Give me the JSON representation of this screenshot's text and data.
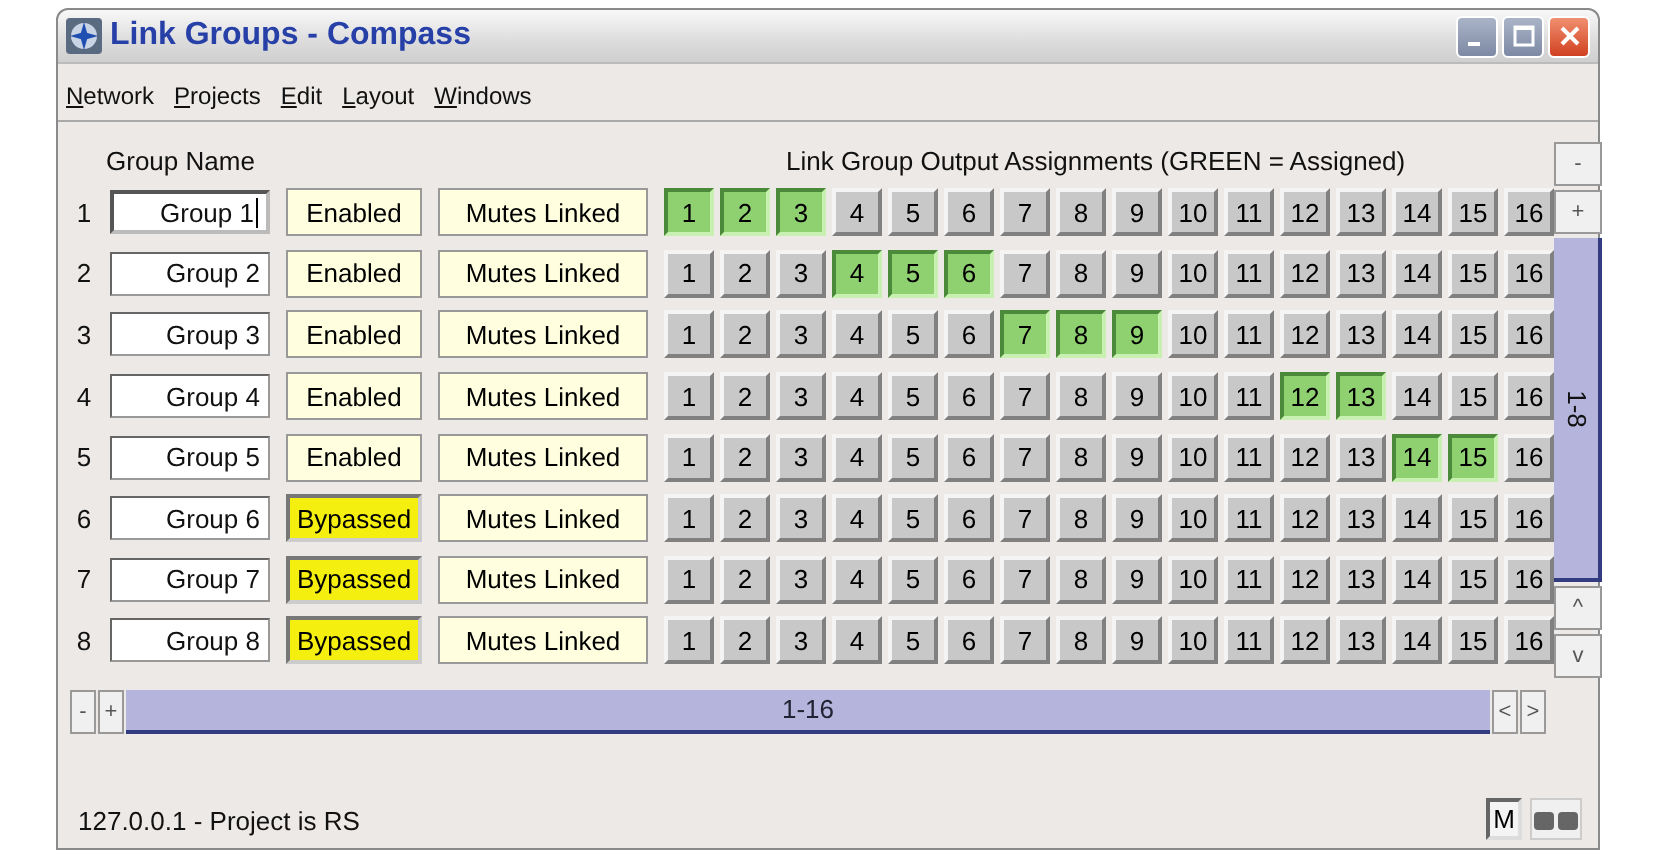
{
  "window": {
    "title": "Link Groups - Compass"
  },
  "menu": [
    {
      "label": "Network"
    },
    {
      "label": "Projects"
    },
    {
      "label": "Edit"
    },
    {
      "label": "Layout"
    },
    {
      "label": "Windows"
    }
  ],
  "headers": {
    "group_name": "Group Name",
    "assignments": "Link Group Output Assignments (GREEN = Assigned)"
  },
  "rows": [
    {
      "number": "1",
      "name": "Group 1",
      "focused": true,
      "mode": {
        "label": "Enabled",
        "kind": "enabled"
      },
      "mutes": "Mutes Linked",
      "outputs": [
        {
          "label": "1",
          "assigned": true
        },
        {
          "label": "2",
          "assigned": true
        },
        {
          "label": "3",
          "assigned": true
        },
        {
          "label": "4",
          "assigned": false
        },
        {
          "label": "5",
          "assigned": false
        },
        {
          "label": "6",
          "assigned": false
        },
        {
          "label": "7",
          "assigned": false
        },
        {
          "label": "8",
          "assigned": false
        },
        {
          "label": "9",
          "assigned": false
        },
        {
          "label": "10",
          "assigned": false
        },
        {
          "label": "11",
          "assigned": false
        },
        {
          "label": "12",
          "assigned": false
        },
        {
          "label": "13",
          "assigned": false
        },
        {
          "label": "14",
          "assigned": false
        },
        {
          "label": "15",
          "assigned": false
        },
        {
          "label": "16",
          "assigned": false
        }
      ]
    },
    {
      "number": "2",
      "name": "Group 2",
      "focused": false,
      "mode": {
        "label": "Enabled",
        "kind": "enabled"
      },
      "mutes": "Mutes Linked",
      "outputs": [
        {
          "label": "1",
          "assigned": false
        },
        {
          "label": "2",
          "assigned": false
        },
        {
          "label": "3",
          "assigned": false
        },
        {
          "label": "4",
          "assigned": true
        },
        {
          "label": "5",
          "assigned": true
        },
        {
          "label": "6",
          "assigned": true
        },
        {
          "label": "7",
          "assigned": false
        },
        {
          "label": "8",
          "assigned": false
        },
        {
          "label": "9",
          "assigned": false
        },
        {
          "label": "10",
          "assigned": false
        },
        {
          "label": "11",
          "assigned": false
        },
        {
          "label": "12",
          "assigned": false
        },
        {
          "label": "13",
          "assigned": false
        },
        {
          "label": "14",
          "assigned": false
        },
        {
          "label": "15",
          "assigned": false
        },
        {
          "label": "16",
          "assigned": false
        }
      ]
    },
    {
      "number": "3",
      "name": "Group 3",
      "focused": false,
      "mode": {
        "label": "Enabled",
        "kind": "enabled"
      },
      "mutes": "Mutes Linked",
      "outputs": [
        {
          "label": "1",
          "assigned": false
        },
        {
          "label": "2",
          "assigned": false
        },
        {
          "label": "3",
          "assigned": false
        },
        {
          "label": "4",
          "assigned": false
        },
        {
          "label": "5",
          "assigned": false
        },
        {
          "label": "6",
          "assigned": false
        },
        {
          "label": "7",
          "assigned": true
        },
        {
          "label": "8",
          "assigned": true
        },
        {
          "label": "9",
          "assigned": true
        },
        {
          "label": "10",
          "assigned": false
        },
        {
          "label": "11",
          "assigned": false
        },
        {
          "label": "12",
          "assigned": false
        },
        {
          "label": "13",
          "assigned": false
        },
        {
          "label": "14",
          "assigned": false
        },
        {
          "label": "15",
          "assigned": false
        },
        {
          "label": "16",
          "assigned": false
        }
      ]
    },
    {
      "number": "4",
      "name": "Group 4",
      "focused": false,
      "mode": {
        "label": "Enabled",
        "kind": "enabled"
      },
      "mutes": "Mutes Linked",
      "outputs": [
        {
          "label": "1",
          "assigned": false
        },
        {
          "label": "2",
          "assigned": false
        },
        {
          "label": "3",
          "assigned": false
        },
        {
          "label": "4",
          "assigned": false
        },
        {
          "label": "5",
          "assigned": false
        },
        {
          "label": "6",
          "assigned": false
        },
        {
          "label": "7",
          "assigned": false
        },
        {
          "label": "8",
          "assigned": false
        },
        {
          "label": "9",
          "assigned": false
        },
        {
          "label": "10",
          "assigned": false
        },
        {
          "label": "11",
          "assigned": false
        },
        {
          "label": "12",
          "assigned": true
        },
        {
          "label": "13",
          "assigned": true
        },
        {
          "label": "14",
          "assigned": false
        },
        {
          "label": "15",
          "assigned": false
        },
        {
          "label": "16",
          "assigned": false
        }
      ]
    },
    {
      "number": "5",
      "name": "Group 5",
      "focused": false,
      "mode": {
        "label": "Enabled",
        "kind": "enabled"
      },
      "mutes": "Mutes Linked",
      "outputs": [
        {
          "label": "1",
          "assigned": false
        },
        {
          "label": "2",
          "assigned": false
        },
        {
          "label": "3",
          "assigned": false
        },
        {
          "label": "4",
          "assigned": false
        },
        {
          "label": "5",
          "assigned": false
        },
        {
          "label": "6",
          "assigned": false
        },
        {
          "label": "7",
          "assigned": false
        },
        {
          "label": "8",
          "assigned": false
        },
        {
          "label": "9",
          "assigned": false
        },
        {
          "label": "10",
          "assigned": false
        },
        {
          "label": "11",
          "assigned": false
        },
        {
          "label": "12",
          "assigned": false
        },
        {
          "label": "13",
          "assigned": false
        },
        {
          "label": "14",
          "assigned": true
        },
        {
          "label": "15",
          "assigned": true
        },
        {
          "label": "16",
          "assigned": false
        }
      ]
    },
    {
      "number": "6",
      "name": "Group 6",
      "focused": false,
      "mode": {
        "label": "Bypassed",
        "kind": "bypassed"
      },
      "mutes": "Mutes Linked",
      "outputs": [
        {
          "label": "1",
          "assigned": false
        },
        {
          "label": "2",
          "assigned": false
        },
        {
          "label": "3",
          "assigned": false
        },
        {
          "label": "4",
          "assigned": false
        },
        {
          "label": "5",
          "assigned": false
        },
        {
          "label": "6",
          "assigned": false
        },
        {
          "label": "7",
          "assigned": false
        },
        {
          "label": "8",
          "assigned": false
        },
        {
          "label": "9",
          "assigned": false
        },
        {
          "label": "10",
          "assigned": false
        },
        {
          "label": "11",
          "assigned": false
        },
        {
          "label": "12",
          "assigned": false
        },
        {
          "label": "13",
          "assigned": false
        },
        {
          "label": "14",
          "assigned": false
        },
        {
          "label": "15",
          "assigned": false
        },
        {
          "label": "16",
          "assigned": false
        }
      ]
    },
    {
      "number": "7",
      "name": "Group 7",
      "focused": false,
      "mode": {
        "label": "Bypassed",
        "kind": "bypassed"
      },
      "mutes": "Mutes Linked",
      "outputs": [
        {
          "label": "1",
          "assigned": false
        },
        {
          "label": "2",
          "assigned": false
        },
        {
          "label": "3",
          "assigned": false
        },
        {
          "label": "4",
          "assigned": false
        },
        {
          "label": "5",
          "assigned": false
        },
        {
          "label": "6",
          "assigned": false
        },
        {
          "label": "7",
          "assigned": false
        },
        {
          "label": "8",
          "assigned": false
        },
        {
          "label": "9",
          "assigned": false
        },
        {
          "label": "10",
          "assigned": false
        },
        {
          "label": "11",
          "assigned": false
        },
        {
          "label": "12",
          "assigned": false
        },
        {
          "label": "13",
          "assigned": false
        },
        {
          "label": "14",
          "assigned": false
        },
        {
          "label": "15",
          "assigned": false
        },
        {
          "label": "16",
          "assigned": false
        }
      ]
    },
    {
      "number": "8",
      "name": "Group 8",
      "focused": false,
      "mode": {
        "label": "Bypassed",
        "kind": "bypassed"
      },
      "mutes": "Mutes Linked",
      "outputs": [
        {
          "label": "1",
          "assigned": false
        },
        {
          "label": "2",
          "assigned": false
        },
        {
          "label": "3",
          "assigned": false
        },
        {
          "label": "4",
          "assigned": false
        },
        {
          "label": "5",
          "assigned": false
        },
        {
          "label": "6",
          "assigned": false
        },
        {
          "label": "7",
          "assigned": false
        },
        {
          "label": "8",
          "assigned": false
        },
        {
          "label": "9",
          "assigned": false
        },
        {
          "label": "10",
          "assigned": false
        },
        {
          "label": "11",
          "assigned": false
        },
        {
          "label": "12",
          "assigned": false
        },
        {
          "label": "13",
          "assigned": false
        },
        {
          "label": "14",
          "assigned": false
        },
        {
          "label": "15",
          "assigned": false
        },
        {
          "label": "16",
          "assigned": false
        }
      ]
    }
  ],
  "vertical_scroll": {
    "minus": "-",
    "plus": "+",
    "range": "1-8",
    "up": "^",
    "down": "v"
  },
  "horizontal_scroll": {
    "minus": "-",
    "plus": "+",
    "range": "1-16",
    "left": "<",
    "right": ">"
  },
  "status_bar": {
    "text": "127.0.0.1 - Project is RS",
    "mode_button": "M"
  }
}
